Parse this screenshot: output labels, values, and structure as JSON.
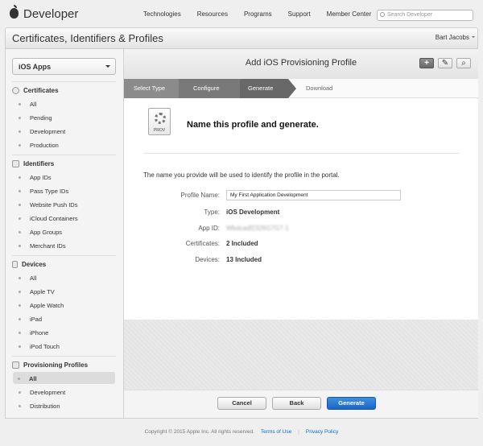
{
  "header": {
    "brand": "Developer",
    "nav": [
      "Technologies",
      "Resources",
      "Programs",
      "Support",
      "Member Center"
    ],
    "search_placeholder": "Search Developer"
  },
  "titlebar": {
    "title": "Certificates, Identifiers & Profiles",
    "user": "Bart Jacobs"
  },
  "sidebar": {
    "platform": "iOS Apps",
    "sections": [
      {
        "title": "Certificates",
        "icon": "certificate-icon",
        "items": [
          "All",
          "Pending",
          "Development",
          "Production"
        ]
      },
      {
        "title": "Identifiers",
        "icon": "id-icon",
        "items": [
          "App IDs",
          "Pass Type IDs",
          "Website Push IDs",
          "iCloud Containers",
          "App Groups",
          "Merchant IDs"
        ]
      },
      {
        "title": "Devices",
        "icon": "device-icon",
        "items": [
          "All",
          "Apple TV",
          "Apple Watch",
          "iPad",
          "iPhone",
          "iPod Touch"
        ]
      },
      {
        "title": "Provisioning Profiles",
        "icon": "profile-icon",
        "items": [
          "All",
          "Development",
          "Distribution"
        ],
        "active": "All"
      }
    ]
  },
  "main": {
    "title": "Add iOS Provisioning Profile",
    "toolbar": {
      "add": "+",
      "edit": "✎",
      "search": "⌕"
    },
    "steps": [
      "Select Type",
      "Configure",
      "Generate",
      "Download"
    ],
    "heading": "Name this profile and generate.",
    "file_label": "PROV",
    "intro": "The name you provide will be used to identify the profile in the portal.",
    "fields": {
      "profile_name": {
        "label": "Profile Name:",
        "value": "My First Application Development"
      },
      "type": {
        "label": "Type:",
        "value": "iOS Development"
      },
      "app_id": {
        "label": "App ID:",
        "value": "Wbdcadf2326G7G7-1"
      },
      "certificates": {
        "label": "Certificates:",
        "value": "2 Included"
      },
      "devices": {
        "label": "Devices:",
        "value": "13 Included"
      }
    },
    "buttons": {
      "cancel": "Cancel",
      "back": "Back",
      "generate": "Generate"
    }
  },
  "footer": {
    "copyright": "Copyright © 2015 Apple Inc. All rights reserved.",
    "terms": "Terms of Use",
    "privacy": "Privacy Policy"
  },
  "colors": {
    "primary": "#1a66c4",
    "step_active": "#686868",
    "link": "#0b6cd8"
  }
}
